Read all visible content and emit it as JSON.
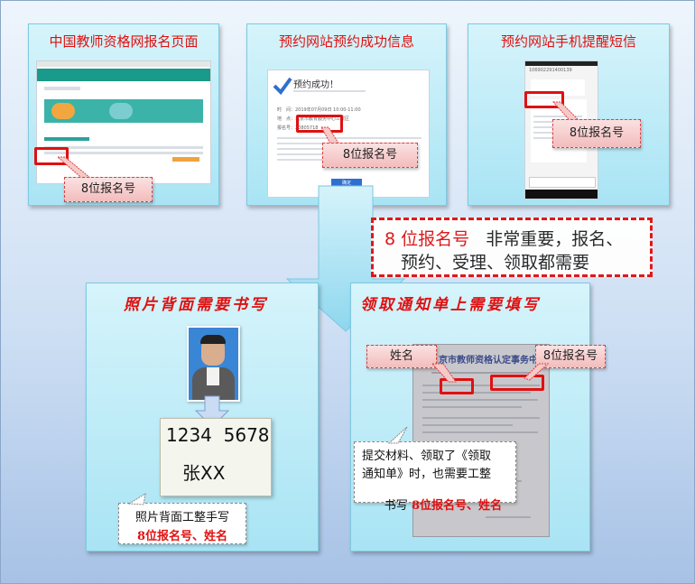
{
  "panels": {
    "registration_page": {
      "title": "中国教师资格网报名页面",
      "callout": "8位报名号"
    },
    "success_info": {
      "title": "预约网站预约成功信息",
      "dialog_heading": "预约成功！",
      "dialog_line1": "时　间：2019年07月09日 10:00-11:00",
      "dialog_line2": "地　点：北京市教育服务中心三层区",
      "dialog_line3": "报名号：20805718",
      "dialog_confirm": "确定",
      "callout": "8位报名号"
    },
    "sms_reminder": {
      "title": "预约网站手机提醒短信",
      "sms_number": "106902291400139",
      "callout": "8位报名号"
    }
  },
  "important_note": {
    "line1_highlight": "8 位报名号",
    "line1_rest": "非常重要，报名、",
    "line2": "预约、受理、领取都需要"
  },
  "photo_panel": {
    "title": "照片背面需要书写",
    "sample_number": "1234  5678",
    "sample_name": "张XX",
    "note_line1": "照片背面工整手写",
    "note_line2": "8位报名号、姓名"
  },
  "notice_panel": {
    "title": "领取通知单上需要填写",
    "doc_header": "京市教师资格认定事务中心",
    "callout_name": "姓名",
    "callout_number": "8位报名号",
    "note_line1": "提交材料、领取了《领取",
    "note_line2": "通知单》时，也需要工整",
    "note_line3_prefix": "书写 ",
    "note_line3_highlight": "8位报名号、姓名"
  },
  "colors": {
    "accent_red": "#e01010",
    "panel_cyan": "#bfeaf6",
    "callout_pink": "#f6c9c9"
  }
}
